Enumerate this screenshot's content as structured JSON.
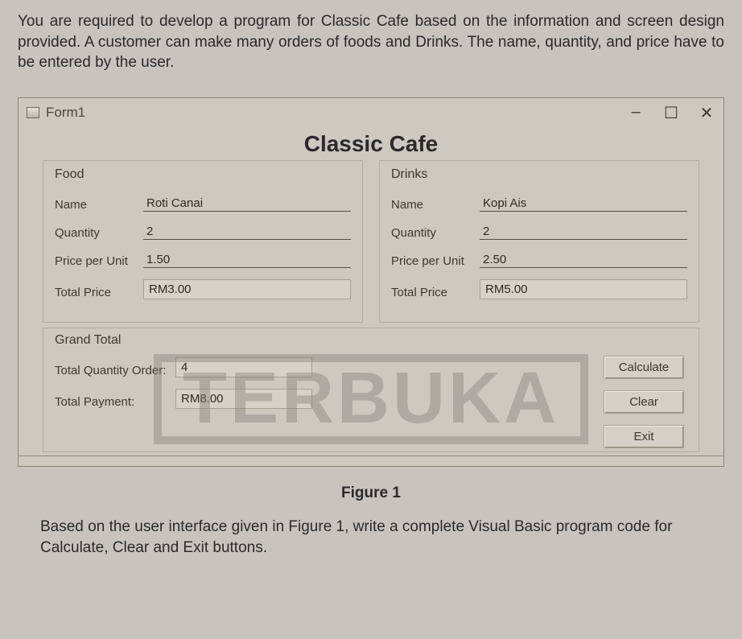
{
  "instruction_top": "You are required to develop a program for Classic Cafe based on the information and screen design provided. A customer can make many orders of foods and Drinks. The name, quantity, and price have to be entered by the user.",
  "window": {
    "title": "Form1",
    "minimize": "–",
    "maximize": "☐",
    "close": "✕"
  },
  "app_title": "Classic Cafe",
  "food": {
    "legend": "Food",
    "name_label": "Name",
    "name_value": "Roti Canai",
    "qty_label": "Quantity",
    "qty_value": "2",
    "ppu_label": "Price per Unit",
    "ppu_value": "1.50",
    "total_label": "Total Price",
    "total_value": "RM3.00"
  },
  "drinks": {
    "legend": "Drinks",
    "name_label": "Name",
    "name_value": "Kopi Ais",
    "qty_label": "Quantity",
    "qty_value": "2",
    "ppu_label": "Price per Unit",
    "ppu_value": "2.50",
    "total_label": "Total Price",
    "total_value": "RM5.00"
  },
  "grand": {
    "legend": "Grand Total",
    "qty_label": "Total Quantity Order:",
    "qty_value": "4",
    "pay_label": "Total Payment:",
    "pay_value": "RM8.00"
  },
  "buttons": {
    "calculate": "Calculate",
    "clear": "Clear",
    "exit": "Exit"
  },
  "figure_caption": "Figure 1",
  "instruction_bottom": "Based on the user interface given in  Figure 1, write a complete Visual Basic program code for Calculate, Clear and Exit buttons.",
  "watermark": "TERBUKA"
}
